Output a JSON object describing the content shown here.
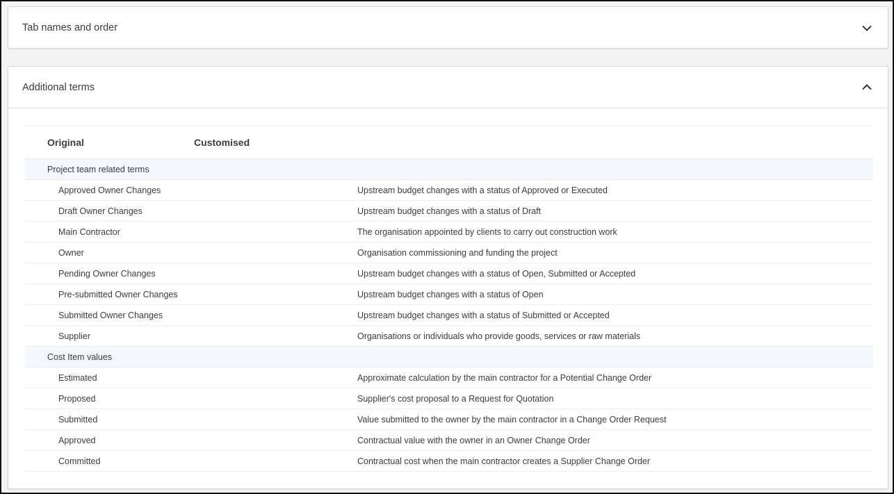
{
  "panels": {
    "tabs": {
      "title": "Tab names and order",
      "expanded": false
    },
    "terms": {
      "title": "Additional terms",
      "expanded": true
    }
  },
  "table": {
    "headers": {
      "original": "Original",
      "customised": "Customised"
    },
    "groups": [
      {
        "label": "Project team related terms",
        "rows": [
          {
            "original": "Approved Owner Changes",
            "description": "Upstream budget changes with a status of Approved or Executed"
          },
          {
            "original": "Draft Owner Changes",
            "description": "Upstream budget changes with a status of Draft"
          },
          {
            "original": "Main Contractor",
            "description": "The organisation appointed by clients to carry out construction work"
          },
          {
            "original": "Owner",
            "description": "Organisation commissioning and funding the project"
          },
          {
            "original": "Pending Owner Changes",
            "description": "Upstream budget changes with a status of Open, Submitted or Accepted"
          },
          {
            "original": "Pre-submitted Owner Changes",
            "description": "Upstream budget changes with a status of Open"
          },
          {
            "original": "Submitted Owner Changes",
            "description": "Upstream budget changes with a status of Submitted or Accepted"
          },
          {
            "original": "Supplier",
            "description": "Organisations or individuals who provide goods, services or raw materials"
          }
        ]
      },
      {
        "label": "Cost Item values",
        "rows": [
          {
            "original": "Estimated",
            "description": "Approximate calculation by the main contractor for a Potential Change Order"
          },
          {
            "original": "Proposed",
            "description": "Supplier's cost proposal to a Request for Quotation"
          },
          {
            "original": "Submitted",
            "description": "Value submitted to the owner by the main contractor in a Change Order Request"
          },
          {
            "original": "Approved",
            "description": "Contractual value with the owner in an Owner Change Order"
          },
          {
            "original": "Committed",
            "description": "Contractual cost when the main contractor creates a Supplier Change Order"
          }
        ]
      }
    ]
  },
  "icons": {
    "tabs_toggle": "chevron-down-icon",
    "terms_toggle": "chevron-up-icon"
  }
}
